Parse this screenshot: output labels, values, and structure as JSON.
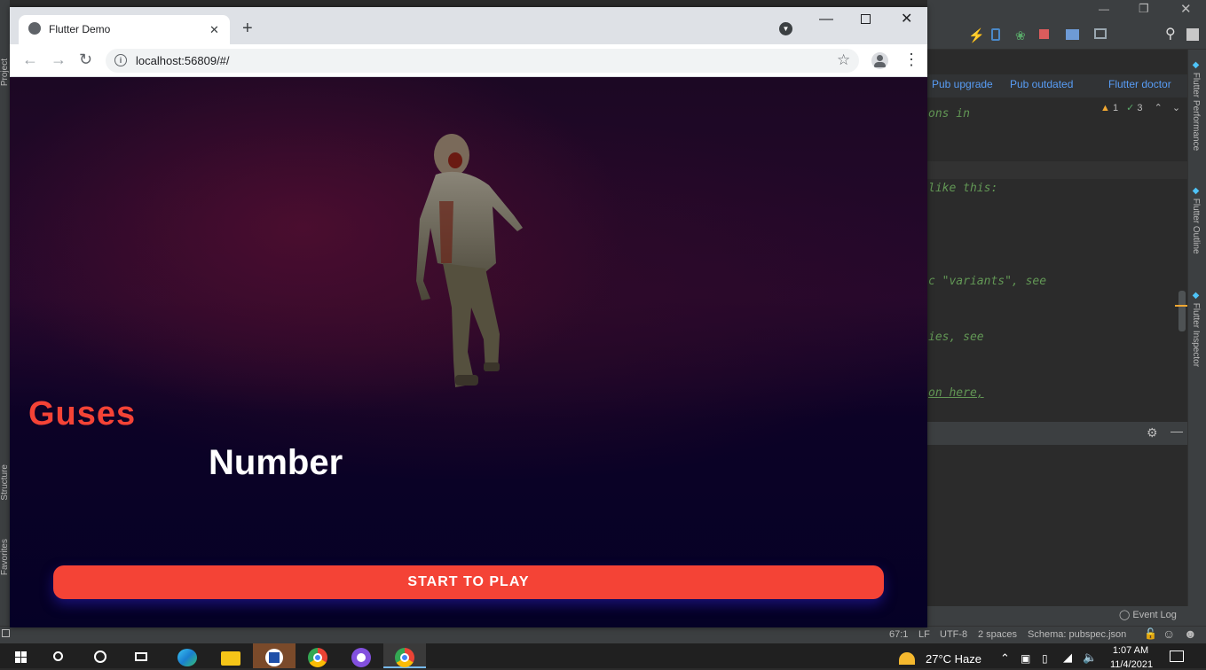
{
  "browser": {
    "tab_title": "Flutter Demo",
    "url": "localhost:56809/#/"
  },
  "app": {
    "title": "Guses",
    "subtitle": "Number",
    "start_button_label": "START TO PLAY",
    "colors": {
      "accent": "#f44336",
      "background_top": "#26082c",
      "background_bottom": "#050126"
    }
  },
  "ide": {
    "pub_links": [
      "Pub upgrade",
      "Pub outdated",
      "Flutter doctor"
    ],
    "warnings_count": "1",
    "checks_count": "3",
    "code_lines": [
      "ons in",
      "like this:",
      "c \"variants\", see",
      "ies, see",
      "on here,"
    ],
    "right_tool_windows": [
      "Flutter Performance",
      "Flutter Outline",
      "Flutter Inspector"
    ],
    "left_tool_windows": [
      "Project",
      "Structure",
      "Favorites"
    ],
    "event_log_label": "Event Log",
    "status": {
      "position": "67:1",
      "line_separator": "LF",
      "encoding": "UTF-8",
      "indent": "2 spaces",
      "schema": "Schema: pubspec.json"
    }
  },
  "taskbar": {
    "weather": "27°C  Haze",
    "time": "1:07 AM",
    "date": "11/4/2021"
  }
}
